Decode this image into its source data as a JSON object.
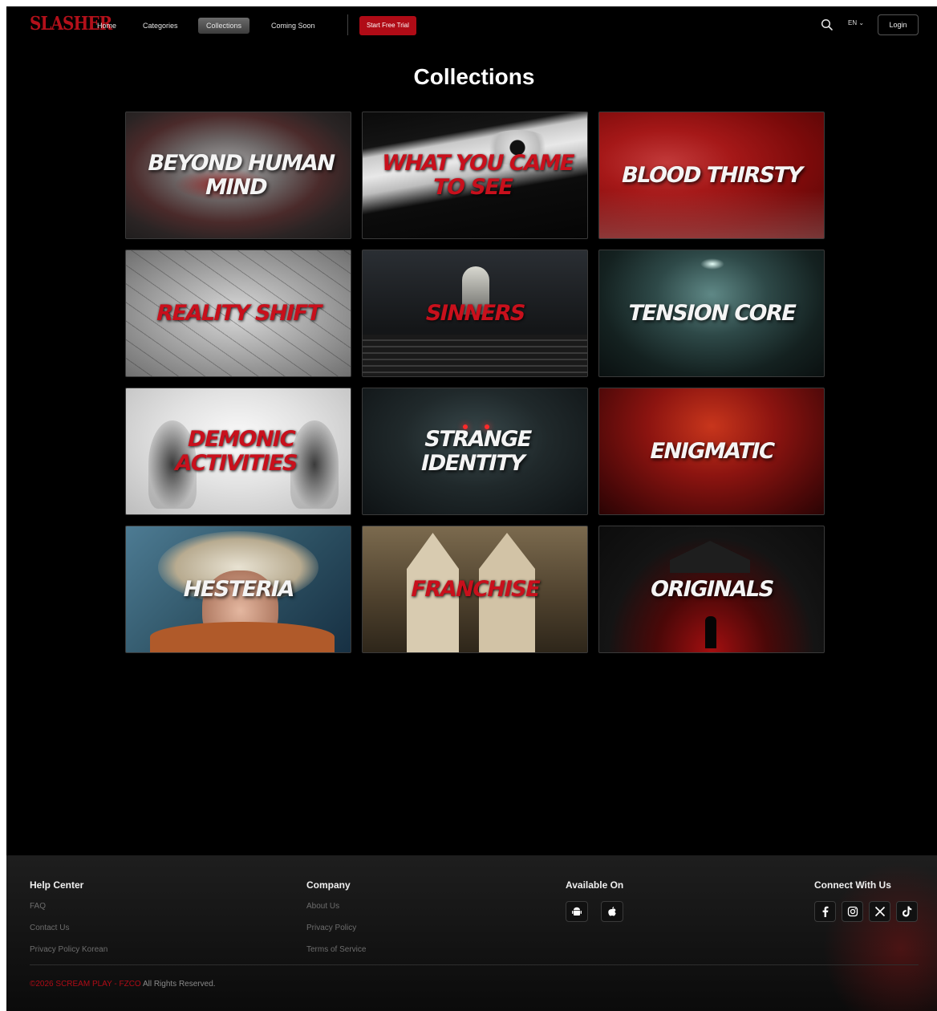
{
  "header": {
    "logo": "SLASHER",
    "nav": [
      {
        "label": "Home"
      },
      {
        "label": "Categories"
      },
      {
        "label": "Collections"
      },
      {
        "label": "Coming Soon"
      }
    ],
    "trial_label": "Start Free Trial",
    "lang_label": "EN ⌄",
    "login_label": "Login"
  },
  "page": {
    "title": "Collections"
  },
  "collections": [
    {
      "title": "BEYOND HUMAN MIND",
      "text_color": "white"
    },
    {
      "title": "WHAT YOU CAME TO SEE",
      "text_color": "red"
    },
    {
      "title": "BLOOD THIRSTY",
      "text_color": "white"
    },
    {
      "title": "REALITY SHIFT",
      "text_color": "red"
    },
    {
      "title": "SINNERS",
      "text_color": "red"
    },
    {
      "title": "TENSION CORE",
      "text_color": "white"
    },
    {
      "title": "DEMONIC ACTIVITIES",
      "text_color": "red"
    },
    {
      "title": "STRANGE IDENTITY",
      "text_color": "white"
    },
    {
      "title": "ENIGMATIC",
      "text_color": "white"
    },
    {
      "title": "HESTERIA",
      "text_color": "white"
    },
    {
      "title": "FRANCHISE",
      "text_color": "red"
    },
    {
      "title": "ORIGINALS",
      "text_color": "white"
    }
  ],
  "footer": {
    "help": {
      "heading": "Help Center",
      "links": [
        "FAQ",
        "Contact Us",
        "Privacy Policy Korean"
      ]
    },
    "company": {
      "heading": "Company",
      "links": [
        "About Us",
        "Privacy Policy",
        "Terms of Service"
      ]
    },
    "available": {
      "heading": "Available On",
      "icons": [
        "android-icon",
        "apple-icon"
      ]
    },
    "connect": {
      "heading": "Connect With Us",
      "icons": [
        "facebook-icon",
        "instagram-icon",
        "x-icon",
        "tiktok-icon"
      ]
    },
    "copyright_brand": "©2026 SCREAM PLAY - FZCO",
    "copyright_rest": " All Rights Reserved."
  },
  "colors": {
    "accent": "#b00b16",
    "background": "#000000"
  }
}
